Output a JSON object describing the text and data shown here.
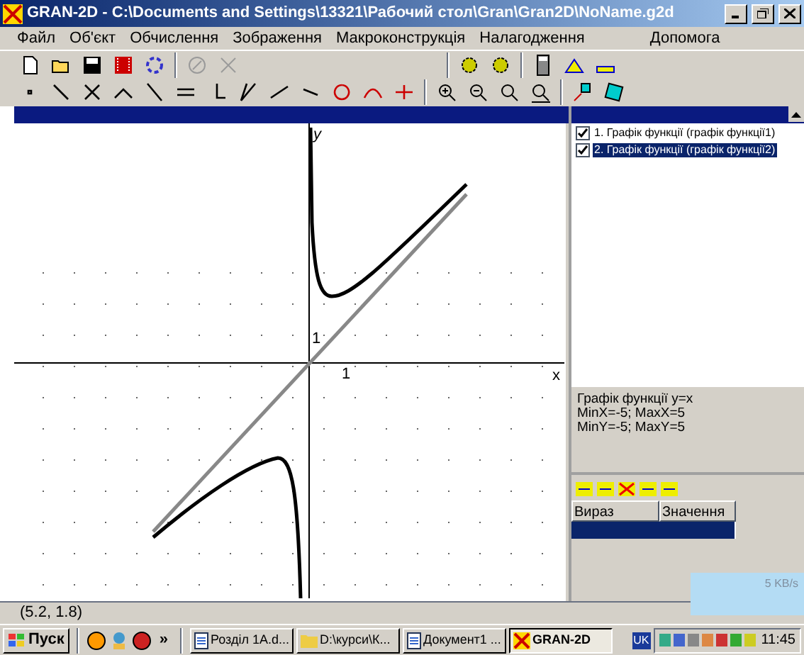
{
  "window": {
    "title": "GRAN-2D - C:\\Documents and Settings\\13321\\Рабочий стол\\Gran\\Gran2D\\NoName.g2d"
  },
  "menu": [
    "Файл",
    "Об'єкт",
    "Обчислення",
    "Зображення",
    "Макроконструкція",
    "Налагодження",
    "Допомога"
  ],
  "toolbar": [
    {
      "kind": "new",
      "disabled": false
    },
    {
      "kind": "open",
      "disabled": false
    },
    {
      "kind": "save",
      "disabled": false
    },
    {
      "kind": "film",
      "disabled": false
    },
    {
      "kind": "cycle",
      "disabled": false
    },
    {
      "kind": "stop",
      "disabled": true
    },
    {
      "kind": "cut",
      "disabled": true
    }
  ],
  "graph": {
    "x_label": "x",
    "y_label": "y",
    "x_tick": "1",
    "y_tick": "1"
  },
  "objects": [
    {
      "label": "1. Графік функції (графік функції1)",
      "checked": true,
      "selected": false
    },
    {
      "label": "2. Графік функції (графік функції2)",
      "checked": true,
      "selected": true
    }
  ],
  "info": [
    "Графік функції y=x",
    "MinX=-5; MaxX=5",
    "MinY=-5; MaxY=5"
  ],
  "expressions": {
    "columns": [
      "Вираз",
      "Значення"
    ]
  },
  "status_bar": "(5.2, 1.8)",
  "net_meter": "5 KB/s",
  "taskbar": {
    "start": "Пуск",
    "more": "»",
    "tasks": [
      {
        "label": "Розділ 1А.d...",
        "kind": "doc",
        "selected": false
      },
      {
        "label": "D:\\курси\\К...",
        "kind": "folder",
        "selected": false
      },
      {
        "label": "Документ1 ...",
        "kind": "doc",
        "selected": false
      },
      {
        "label": "GRAN-2D",
        "kind": "app",
        "selected": true
      }
    ],
    "lang": "UK",
    "time": "11:45"
  }
}
